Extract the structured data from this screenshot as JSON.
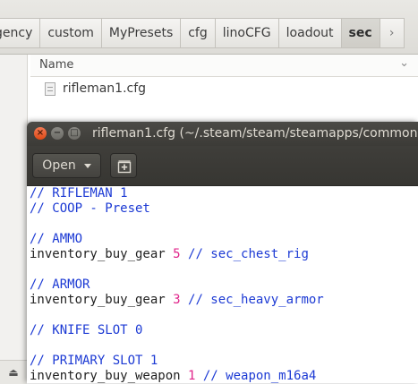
{
  "file_manager": {
    "breadcrumbs": [
      "gency",
      "custom",
      "MyPresets",
      "cfg",
      "linoCFG",
      "loadout",
      "sec"
    ],
    "active_crumb": "sec",
    "scroll_arrow": "›",
    "column_header": "Name",
    "files": [
      {
        "name": "rifleman1.cfg",
        "icon": "text-file-icon"
      }
    ]
  },
  "editor_window": {
    "title": "rifleman1.cfg (~/.steam/steam/steamapps/common",
    "open_label": "Open",
    "close_glyph": "×",
    "min_glyph": "−",
    "max_glyph": "□",
    "lines": [
      {
        "parts": [
          {
            "t": "// RIFLEMAN 1",
            "k": "c"
          }
        ]
      },
      {
        "parts": [
          {
            "t": "// COOP - Preset",
            "k": "c"
          }
        ]
      },
      {
        "parts": []
      },
      {
        "parts": [
          {
            "t": "// AMMO",
            "k": "c"
          }
        ]
      },
      {
        "parts": [
          {
            "t": "inventory_buy_gear ",
            "k": ""
          },
          {
            "t": "5",
            "k": "n"
          },
          {
            "t": " // sec_chest_rig",
            "k": "c"
          }
        ]
      },
      {
        "parts": []
      },
      {
        "parts": [
          {
            "t": "// ARMOR",
            "k": "c"
          }
        ]
      },
      {
        "parts": [
          {
            "t": "inventory_buy_gear ",
            "k": ""
          },
          {
            "t": "3",
            "k": "n"
          },
          {
            "t": " // sec_heavy_armor",
            "k": "c"
          }
        ]
      },
      {
        "parts": []
      },
      {
        "parts": [
          {
            "t": "// KNIFE SLOT 0",
            "k": "c"
          }
        ]
      },
      {
        "parts": []
      },
      {
        "parts": [
          {
            "t": "// PRIMARY SLOT 1",
            "k": "c"
          }
        ]
      },
      {
        "parts": [
          {
            "t": "inventory_buy_weapon ",
            "k": ""
          },
          {
            "t": "1",
            "k": "n"
          },
          {
            "t": " // weapon_m16a4",
            "k": "c"
          }
        ]
      }
    ]
  },
  "colors": {
    "comment": "#1c3ad4",
    "number": "#e0238a",
    "titlebar": "#3c3b37",
    "close_button": "#df4a16"
  }
}
